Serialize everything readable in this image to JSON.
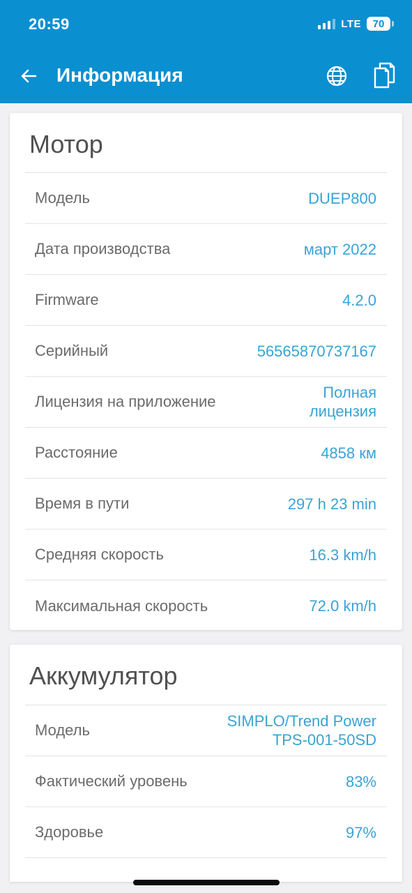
{
  "status": {
    "time": "20:59",
    "network": "LTE",
    "battery": "70"
  },
  "appbar": {
    "title": "Информация",
    "back_icon": "arrow-left-icon",
    "globe_icon": "globe-icon",
    "copy_icon": "copy-document-icon"
  },
  "motor": {
    "title": "Мотор",
    "rows": [
      {
        "label": "Модель",
        "value": "DUEP800"
      },
      {
        "label": "Дата производства",
        "value": "март 2022"
      },
      {
        "label": "Firmware",
        "value": "4.2.0"
      },
      {
        "label": "Серийный",
        "value": "56565870737167"
      },
      {
        "label": "Лицензия на приложение",
        "value_line1": "Полная",
        "value_line2": "лицензия"
      },
      {
        "label": "Расстояние",
        "value": "4858 км"
      },
      {
        "label": "Время в пути",
        "value": "297 h 23 min"
      },
      {
        "label": "Средняя скорость",
        "value": "16.3 km/h"
      },
      {
        "label": "Максимальная скорость",
        "value": "72.0 km/h"
      }
    ]
  },
  "battery": {
    "title": "Аккумулятор",
    "rows": [
      {
        "label": "Модель",
        "value_line1": "SIMPLO/Trend Power",
        "value_line2": "TPS-001-50SD"
      },
      {
        "label": "Фактический уровень",
        "value": "83%"
      },
      {
        "label": "Здоровье",
        "value": "97%"
      }
    ]
  },
  "colors": {
    "accent": "#0a8fd1",
    "value": "#3aa3d3",
    "label": "#6b6b6b",
    "background": "#f1f1f3"
  }
}
